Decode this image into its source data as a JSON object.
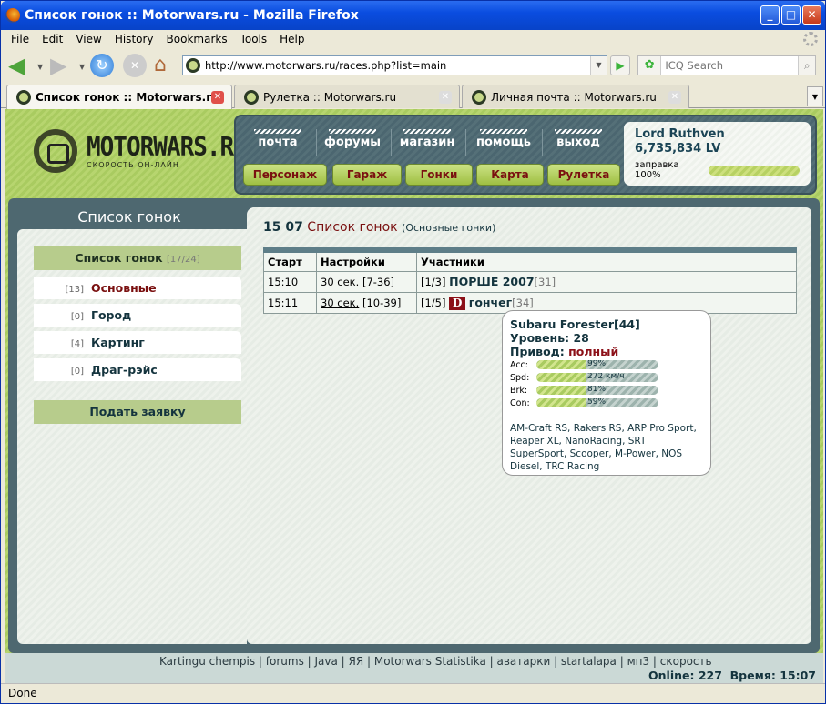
{
  "window": {
    "title": "Список гонок :: Motorwars.ru - Mozilla Firefox",
    "buttons": {
      "minimize": "_",
      "maximize": "□",
      "close": "✕"
    }
  },
  "menu": [
    "File",
    "Edit",
    "View",
    "History",
    "Bookmarks",
    "Tools",
    "Help"
  ],
  "toolbar": {
    "url": "http://www.motorwars.ru/races.php?list=main",
    "search_placeholder": "ICQ Search"
  },
  "tabs": [
    {
      "label": "Список гонок :: Motorwars.ru",
      "active": true
    },
    {
      "label": "Рулетка :: Motorwars.ru"
    },
    {
      "label": "Личная почта :: Motorwars.ru"
    }
  ],
  "site": {
    "logo": {
      "name": "MOTORWARS.RU",
      "tagline": "СКОРОСТЬ ОН-ЛАЙН"
    },
    "top_links": [
      "почта",
      "форумы",
      "магазин",
      "помощь",
      "выход"
    ],
    "nav_buttons": [
      "Персонаж",
      "Гараж",
      "Гонки",
      "Карта",
      "Рулетка"
    ],
    "user": {
      "name": "Lord Ruthven",
      "balance": "6,735,834 LV",
      "fuel_label": "заправка 100%",
      "fuel_percent": 100
    }
  },
  "sidebar": {
    "title": "Список гонок",
    "header": {
      "label": "Список гонок",
      "count": "[17/24]"
    },
    "items": [
      {
        "count": "[13]",
        "label": "Основные",
        "active": true
      },
      {
        "count": "[0]",
        "label": "Город"
      },
      {
        "count": "[4]",
        "label": "Картинг"
      },
      {
        "count": "[0]",
        "label": "Драг-рэйс"
      }
    ],
    "submit_button": "Подать заявку"
  },
  "main": {
    "time": "15 07",
    "title": "Список гонок",
    "subtitle": "(Основные гонки)",
    "columns": [
      "Старт",
      "Настройки",
      "Участники"
    ],
    "rows": [
      {
        "start": "15:10",
        "setting_link": "30 сек.",
        "setting_range": "[7-36]",
        "slots": "[1/3]",
        "player": "ПОРШЕ 2007",
        "level": "[31]",
        "has_team_logo": false
      },
      {
        "start": "15:11",
        "setting_link": "30 сек.",
        "setting_range": "[10-39]",
        "slots": "[1/5]",
        "player": "гончег",
        "level": "[34]",
        "team_logo": "D",
        "has_team_logo": true
      }
    ]
  },
  "tooltip": {
    "car": "Subaru Forester[44]",
    "level": "Уровень: 28",
    "drive_label": "Привод:",
    "drive_value": "полный",
    "stats": [
      {
        "key": "Acc:",
        "value": "99%",
        "fill": 0.4
      },
      {
        "key": "Spd:",
        "value": "272 км/ч",
        "fill": 0.4
      },
      {
        "key": "Brk:",
        "value": "81%",
        "fill": 0.4
      },
      {
        "key": "Con:",
        "value": "59%",
        "fill": 0.4
      }
    ],
    "brands": "AM-Craft RS, Rakers RS, ARP Pro Sport, Reaper XL, NanoRacing, SRT SuperSport, Scooper, M-Power, NOS Diesel, TRC Racing"
  },
  "footer": {
    "links": "Kartingu chempis | forums | Java | ЯЯ | Motorwars Statistika | аватарки | startalapa | мп3 | скорость",
    "online": "Online: 227",
    "time": "Время: 15:07"
  },
  "status": "Done"
}
